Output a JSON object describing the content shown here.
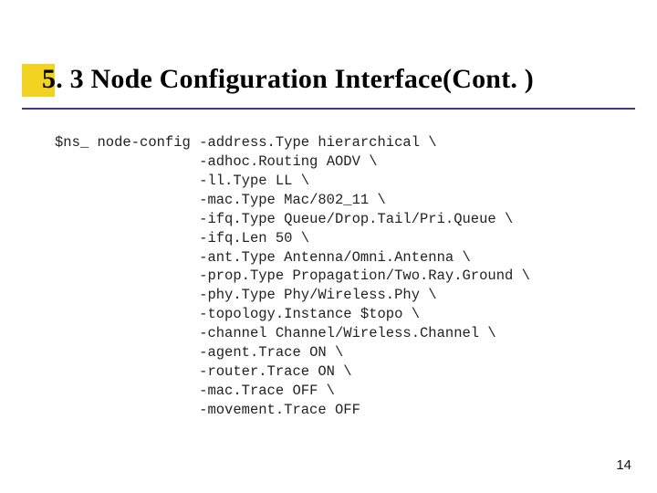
{
  "title": "5. 3   Node Configuration Interface(Cont. )",
  "page_number": "14",
  "code": {
    "command": "$ns_ node-config",
    "options": [
      {
        "flag": "-address.Type",
        "value": "hierarchical",
        "cont": true
      },
      {
        "flag": "-adhoc.Routing",
        "value": "AODV",
        "cont": true
      },
      {
        "flag": "-ll.Type",
        "value": "LL",
        "cont": true
      },
      {
        "flag": "-mac.Type",
        "value": "Mac/802_11",
        "cont": true
      },
      {
        "flag": "-ifq.Type",
        "value": "Queue/Drop.Tail/Pri.Queue",
        "cont": true
      },
      {
        "flag": "-ifq.Len",
        "value": "50",
        "cont": true
      },
      {
        "flag": "-ant.Type",
        "value": "Antenna/Omni.Antenna",
        "cont": true
      },
      {
        "flag": "-prop.Type",
        "value": "Propagation/Two.Ray.Ground",
        "cont": true
      },
      {
        "flag": "-phy.Type",
        "value": "Phy/Wireless.Phy",
        "cont": true
      },
      {
        "flag": "-topology.Instance",
        "value": "$topo",
        "cont": true
      },
      {
        "flag": "-channel",
        "value": "Channel/Wireless.Channel",
        "cont": true
      },
      {
        "flag": "-agent.Trace",
        "value": "ON",
        "cont": true
      },
      {
        "flag": "-router.Trace",
        "value": "ON",
        "cont": true
      },
      {
        "flag": "-mac.Trace",
        "value": "OFF",
        "cont": true
      },
      {
        "flag": "-movement.Trace",
        "value": "OFF",
        "cont": false
      }
    ]
  }
}
